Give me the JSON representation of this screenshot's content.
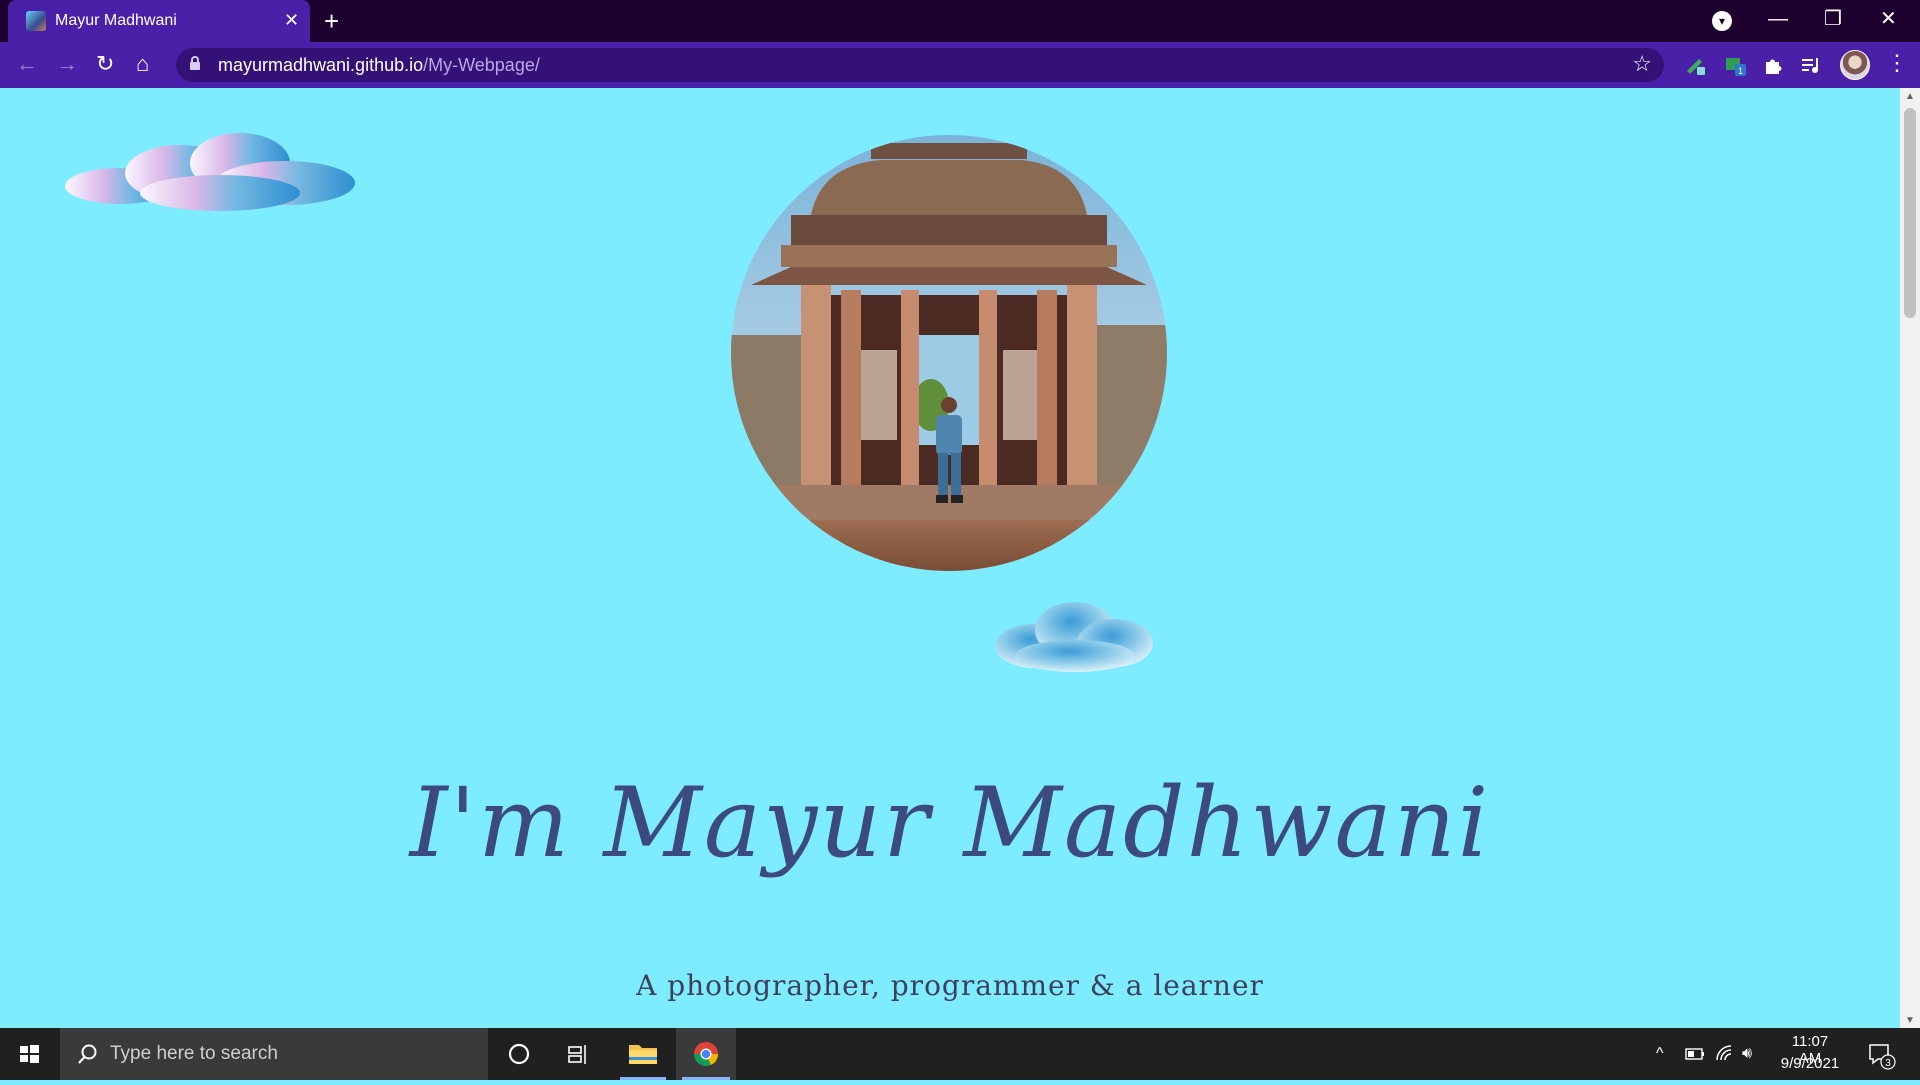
{
  "browser": {
    "tab_title": "Mayur Madhwani",
    "tab_close_icon": "close-icon",
    "new_tab_label": "+",
    "url_host": "mayurmadhwani.github.io",
    "url_path": "/My-Webpage/",
    "accent_color": "#4b20a8",
    "frame_color": "#1e002e"
  },
  "page": {
    "heading": "I'm Mayur Madhwani",
    "subtitle": "A photographer, programmer & a learner",
    "background_color": "#7eecff",
    "heading_color": "#3c4a80"
  },
  "taskbar": {
    "search_placeholder": "Type here to search",
    "time": "11:07 AM",
    "date": "9/9/2021",
    "notification_count": "3",
    "extension_badge": "1"
  }
}
